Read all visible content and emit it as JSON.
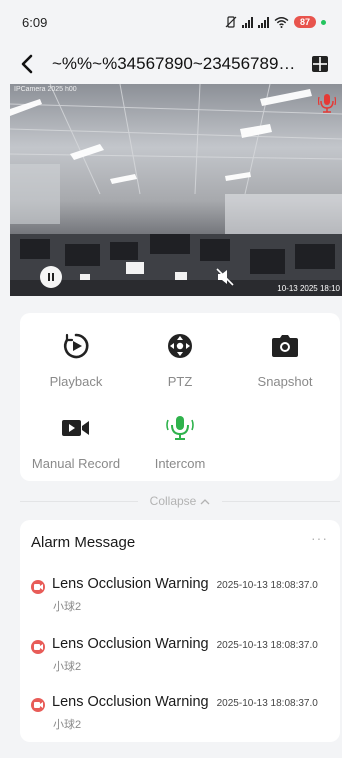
{
  "status_bar": {
    "time": "6:09",
    "battery": "87",
    "signal_label_1": "",
    "signal_label_2": ""
  },
  "header": {
    "title": "~%%~%34567890~234567890~2..."
  },
  "video": {
    "camera_label": "IPCamera 2025 h00",
    "timestamp": "10-13 2025 18:10"
  },
  "controls": [
    {
      "label": "Playback",
      "icon": "playback-icon"
    },
    {
      "label": "PTZ",
      "icon": "ptz-icon"
    },
    {
      "label": "Snapshot",
      "icon": "camera-icon"
    },
    {
      "label": "Manual Record",
      "icon": "video-record-icon"
    },
    {
      "label": "Intercom",
      "icon": "microphone-icon"
    }
  ],
  "collapse_label": "Collapse",
  "alarm": {
    "title": "Alarm Message",
    "more": "···",
    "items": [
      {
        "name": "Lens Occlusion Warning",
        "time": "2025-10-13 18:08:37.0",
        "device": "小球2"
      },
      {
        "name": "Lens Occlusion Warning",
        "time": "2025-10-13 18:08:37.0",
        "device": "小球2"
      },
      {
        "name": "Lens Occlusion Warning",
        "time": "2025-10-13 18:08:37.0",
        "device": "小球2"
      }
    ]
  },
  "colors": {
    "accent_green": "#2fb24c",
    "alarm_red": "#e85c58",
    "battery_red": "#e8544d",
    "background": "#f3f4f6"
  }
}
